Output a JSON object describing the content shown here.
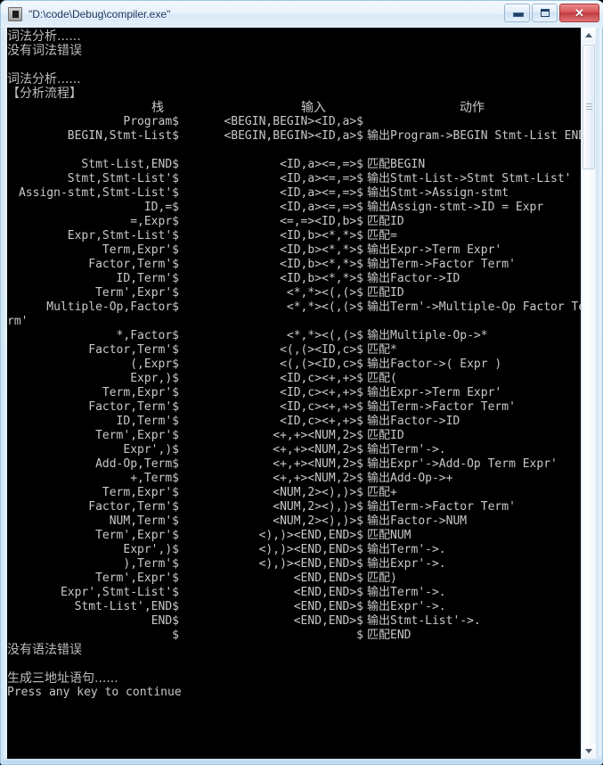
{
  "window": {
    "title": "\"D:\\code\\Debug\\compiler.exe\"",
    "icon": "console-app-icon",
    "buttons": {
      "minimize": "minimize-button",
      "maximize": "maximize-button",
      "close_glyph": "✕"
    }
  },
  "console": {
    "preamble": [
      {
        "text": "词法分析......",
        "cjk": true
      },
      {
        "text": "没有词法错误",
        "cjk": true
      },
      {
        "text": "",
        "cjk": false
      },
      {
        "text": "词法分析......",
        "cjk": true
      },
      {
        "text": "【分析流程】",
        "cjk": true
      }
    ],
    "headers": {
      "stack": "栈",
      "input": "输入",
      "action": "动作"
    },
    "rows": [
      {
        "stack": "Program$",
        "input": "<BEGIN,BEGIN><ID,a>$",
        "verb": "",
        "action": ""
      },
      {
        "stack": "BEGIN,Stmt-List$",
        "input": "<BEGIN,BEGIN><ID,a>$",
        "verb": "输出",
        "action": "Program->BEGIN Stmt-List END"
      },
      {
        "stack": "",
        "input": "",
        "verb": "",
        "action": ""
      },
      {
        "stack": "Stmt-List,END$",
        "input": "<ID,a><=,=>$",
        "verb": "匹配",
        "action": "BEGIN"
      },
      {
        "stack": "Stmt,Stmt-List'$",
        "input": "<ID,a><=,=>$",
        "verb": "输出",
        "action": "Stmt-List->Stmt Stmt-List'"
      },
      {
        "stack": "Assign-stmt,Stmt-List'$",
        "input": "<ID,a><=,=>$",
        "verb": "输出",
        "action": "Stmt->Assign-stmt"
      },
      {
        "stack": "ID,=$",
        "input": "<ID,a><=,=>$",
        "verb": "输出",
        "action": "Assign-stmt->ID = Expr"
      },
      {
        "stack": "=,Expr$",
        "input": "<=,=><ID,b>$",
        "verb": "匹配",
        "action": "ID"
      },
      {
        "stack": "Expr,Stmt-List'$",
        "input": "<ID,b><*,*>$",
        "verb": "匹配",
        "action": "="
      },
      {
        "stack": "Term,Expr'$",
        "input": "<ID,b><*,*>$",
        "verb": "输出",
        "action": "Expr->Term Expr'"
      },
      {
        "stack": "Factor,Term'$",
        "input": "<ID,b><*,*>$",
        "verb": "输出",
        "action": "Term->Factor Term'"
      },
      {
        "stack": "ID,Term'$",
        "input": "<ID,b><*,*>$",
        "verb": "输出",
        "action": "Factor->ID"
      },
      {
        "stack": "Term',Expr'$",
        "input": "<*,*><(,(>$",
        "verb": "匹配",
        "action": "ID"
      },
      {
        "stack": "Multiple-Op,Factor$",
        "input": "<*,*><(,(>$",
        "verb": "输出",
        "action": "Term'->Multiple-Op Factor Term'",
        "wrap": "rm'"
      },
      {
        "stack": "*,Factor$",
        "input": "<*,*><(,(>$",
        "verb": "输出",
        "action": "Multiple-Op->*"
      },
      {
        "stack": "Factor,Term'$",
        "input": "<(,(><ID,c>$",
        "verb": "匹配",
        "action": "*"
      },
      {
        "stack": "(,Expr$",
        "input": "<(,(><ID,c>$",
        "verb": "输出",
        "action": "Factor->( Expr )"
      },
      {
        "stack": "Expr,)$",
        "input": "<ID,c><+,+>$",
        "verb": "匹配",
        "action": "("
      },
      {
        "stack": "Term,Expr'$",
        "input": "<ID,c><+,+>$",
        "verb": "输出",
        "action": "Expr->Term Expr'"
      },
      {
        "stack": "Factor,Term'$",
        "input": "<ID,c><+,+>$",
        "verb": "输出",
        "action": "Term->Factor Term'"
      },
      {
        "stack": "ID,Term'$",
        "input": "<ID,c><+,+>$",
        "verb": "输出",
        "action": "Factor->ID"
      },
      {
        "stack": "Term',Expr'$",
        "input": "<+,+><NUM,2>$",
        "verb": "匹配",
        "action": "ID"
      },
      {
        "stack": "Expr',)$",
        "input": "<+,+><NUM,2>$",
        "verb": "输出",
        "action": "Term'->."
      },
      {
        "stack": "Add-Op,Term$",
        "input": "<+,+><NUM,2>$",
        "verb": "输出",
        "action": "Expr'->Add-Op Term Expr'"
      },
      {
        "stack": "+,Term$",
        "input": "<+,+><NUM,2>$",
        "verb": "输出",
        "action": "Add-Op->+"
      },
      {
        "stack": "Term,Expr'$",
        "input": "<NUM,2><),)>$",
        "verb": "匹配",
        "action": "+"
      },
      {
        "stack": "Factor,Term'$",
        "input": "<NUM,2><),)>$",
        "verb": "输出",
        "action": "Term->Factor Term'"
      },
      {
        "stack": "NUM,Term'$",
        "input": "<NUM,2><),)>$",
        "verb": "输出",
        "action": "Factor->NUM"
      },
      {
        "stack": "Term',Expr'$",
        "input": "<),)><END,END>$",
        "verb": "匹配",
        "action": "NUM"
      },
      {
        "stack": "Expr',)$",
        "input": "<),)><END,END>$",
        "verb": "输出",
        "action": "Term'->."
      },
      {
        "stack": "),Term'$",
        "input": "<),)><END,END>$",
        "verb": "输出",
        "action": "Expr'->."
      },
      {
        "stack": "Term',Expr'$",
        "input": "<END,END>$",
        "verb": "匹配",
        "action": ")"
      },
      {
        "stack": "Expr',Stmt-List'$",
        "input": "<END,END>$",
        "verb": "输出",
        "action": "Term'->."
      },
      {
        "stack": "Stmt-List',END$",
        "input": "<END,END>$",
        "verb": "输出",
        "action": "Expr'->."
      },
      {
        "stack": "END$",
        "input": "<END,END>$",
        "verb": "输出",
        "action": "Stmt-List'->."
      },
      {
        "stack": "$",
        "input": "$",
        "verb": "匹配",
        "action": "END"
      }
    ],
    "epilogue": [
      {
        "text": "没有语法错误",
        "cjk": true
      },
      {
        "text": "",
        "cjk": false
      },
      {
        "text": "生成三地址语句......",
        "cjk": true
      },
      {
        "text": "Press any key to continue",
        "cjk": false
      }
    ]
  },
  "scrollbar": {
    "up_arrow": "scroll-up-arrow",
    "down_arrow": "scroll-down-arrow",
    "thumb": "scroll-thumb"
  }
}
